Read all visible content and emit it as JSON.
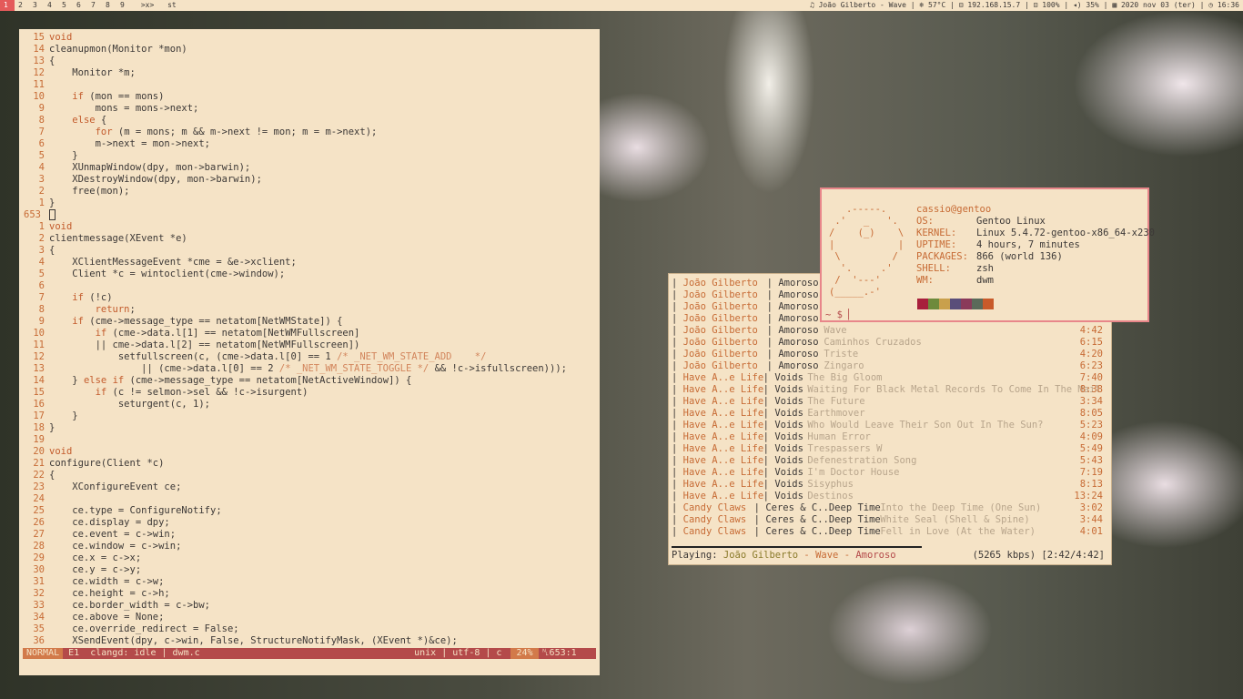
{
  "topbar": {
    "tags": [
      "1",
      "2",
      "3",
      "4",
      "5",
      "6",
      "7",
      "8",
      "9"
    ],
    "selected_tag": "1",
    "layout": ">x>",
    "window_title": "st",
    "status": "♫ João Gilberto - Wave | ❄ 57°C | ⊟ 192.168.15.7 | ⊡ 100% | ◂) 35% | ▦ 2020 nov 03 (ter) | ◷ 16:36"
  },
  "vim": {
    "lines": [
      {
        "n": "15",
        "t": "void"
      },
      {
        "n": "14",
        "t": "cleanupmon(Monitor *mon)"
      },
      {
        "n": "13",
        "t": "{"
      },
      {
        "n": "12",
        "t": "    Monitor *m;"
      },
      {
        "n": "11",
        "t": ""
      },
      {
        "n": "10",
        "t": "    if (mon == mons)"
      },
      {
        "n": "9",
        "t": "        mons = mons->next;"
      },
      {
        "n": "8",
        "t": "    else {"
      },
      {
        "n": "7",
        "t": "        for (m = mons; m && m->next != mon; m = m->next);"
      },
      {
        "n": "6",
        "t": "        m->next = mon->next;"
      },
      {
        "n": "5",
        "t": "    }"
      },
      {
        "n": "4",
        "t": "    XUnmapWindow(dpy, mon->barwin);"
      },
      {
        "n": "3",
        "t": "    XDestroyWindow(dpy, mon->barwin);"
      },
      {
        "n": "2",
        "t": "    free(mon);"
      },
      {
        "n": "1",
        "t": "}"
      },
      {
        "n": "653",
        "t": "█"
      },
      {
        "n": "1",
        "t": "void"
      },
      {
        "n": "2",
        "t": "clientmessage(XEvent *e)"
      },
      {
        "n": "3",
        "t": "{"
      },
      {
        "n": "4",
        "t": "    XClientMessageEvent *cme = &e->xclient;"
      },
      {
        "n": "5",
        "t": "    Client *c = wintoclient(cme->window);"
      },
      {
        "n": "6",
        "t": ""
      },
      {
        "n": "7",
        "t": "    if (!c)"
      },
      {
        "n": "8",
        "t": "        return;"
      },
      {
        "n": "9",
        "t": "    if (cme->message_type == netatom[NetWMState]) {"
      },
      {
        "n": "10",
        "t": "        if (cme->data.l[1] == netatom[NetWMFullscreen]"
      },
      {
        "n": "11",
        "t": "        || cme->data.l[2] == netatom[NetWMFullscreen])"
      },
      {
        "n": "12",
        "t": "            setfullscreen(c, (cme->data.l[0] == 1 /* _NET_WM_STATE_ADD    */"
      },
      {
        "n": "13",
        "t": "                || (cme->data.l[0] == 2 /* _NET_WM_STATE_TOGGLE */ && !c->isfullscreen)));"
      },
      {
        "n": "14",
        "t": "    } else if (cme->message_type == netatom[NetActiveWindow]) {"
      },
      {
        "n": "15",
        "t": "        if (c != selmon->sel && !c->isurgent)"
      },
      {
        "n": "16",
        "t": "            seturgent(c, 1);"
      },
      {
        "n": "17",
        "t": "    }"
      },
      {
        "n": "18",
        "t": "}"
      },
      {
        "n": "19",
        "t": ""
      },
      {
        "n": "20",
        "t": "void"
      },
      {
        "n": "21",
        "t": "configure(Client *c)"
      },
      {
        "n": "22",
        "t": "{"
      },
      {
        "n": "23",
        "t": "    XConfigureEvent ce;"
      },
      {
        "n": "24",
        "t": ""
      },
      {
        "n": "25",
        "t": "    ce.type = ConfigureNotify;"
      },
      {
        "n": "26",
        "t": "    ce.display = dpy;"
      },
      {
        "n": "27",
        "t": "    ce.event = c->win;"
      },
      {
        "n": "28",
        "t": "    ce.window = c->win;"
      },
      {
        "n": "29",
        "t": "    ce.x = c->x;"
      },
      {
        "n": "30",
        "t": "    ce.y = c->y;"
      },
      {
        "n": "31",
        "t": "    ce.width = c->w;"
      },
      {
        "n": "32",
        "t": "    ce.height = c->h;"
      },
      {
        "n": "33",
        "t": "    ce.border_width = c->bw;"
      },
      {
        "n": "34",
        "t": "    ce.above = None;"
      },
      {
        "n": "35",
        "t": "    ce.override_redirect = False;"
      },
      {
        "n": "36",
        "t": "    XSendEvent(dpy, c->win, False, StructureNotifyMask, (XEvent *)&ce);"
      }
    ],
    "status": {
      "mode": "NORMAL",
      "info": " E1  clangd: idle | dwm.c",
      "fileinfo": "unix | utf-8 | c ",
      "percent": "24%",
      "position": "␤653:1"
    }
  },
  "music": {
    "rows": [
      {
        "artist": "João Gilberto",
        "album": "Amoroso",
        "title": "",
        "dur": ""
      },
      {
        "artist": "João Gilberto",
        "album": "Amoroso",
        "title": "",
        "dur": ""
      },
      {
        "artist": "João Gilberto",
        "album": "Amoroso",
        "title": "",
        "dur": ""
      },
      {
        "artist": "João Gilberto",
        "album": "Amoroso",
        "title": "",
        "dur": ""
      },
      {
        "artist": "João Gilberto",
        "album": "Amoroso",
        "title": "Wave",
        "dur": "4:42"
      },
      {
        "artist": "João Gilberto",
        "album": "Amoroso",
        "title": "Caminhos Cruzados",
        "dur": "6:15"
      },
      {
        "artist": "João Gilberto",
        "album": "Amoroso",
        "title": "Triste",
        "dur": "4:20"
      },
      {
        "artist": "João Gilberto",
        "album": "Amoroso",
        "title": "Zingaro",
        "dur": "6:23"
      },
      {
        "artist": "Have A..e Life",
        "album": "Voids",
        "title": "The Big Gloom",
        "dur": "7:40"
      },
      {
        "artist": "Have A..e Life",
        "album": "Voids",
        "title": "Waiting For Black Metal Records To Come In The Mail",
        "dur": "8:38"
      },
      {
        "artist": "Have A..e Life",
        "album": "Voids",
        "title": "The Future",
        "dur": "3:34"
      },
      {
        "artist": "Have A..e Life",
        "album": "Voids",
        "title": "Earthmover",
        "dur": "8:05"
      },
      {
        "artist": "Have A..e Life",
        "album": "Voids",
        "title": "Who Would Leave Their Son Out In The Sun?",
        "dur": "5:23"
      },
      {
        "artist": "Have A..e Life",
        "album": "Voids",
        "title": "Human Error",
        "dur": "4:09"
      },
      {
        "artist": "Have A..e Life",
        "album": "Voids",
        "title": "Trespassers W",
        "dur": "5:49"
      },
      {
        "artist": "Have A..e Life",
        "album": "Voids",
        "title": "Defenestration Song",
        "dur": "5:43"
      },
      {
        "artist": "Have A..e Life",
        "album": "Voids",
        "title": "I'm Doctor House",
        "dur": "7:19"
      },
      {
        "artist": "Have A..e Life",
        "album": "Voids",
        "title": "Sisyphus",
        "dur": "8:13"
      },
      {
        "artist": "Have A..e Life",
        "album": "Voids",
        "title": "Destinos",
        "dur": "13:24"
      },
      {
        "artist": "Candy Claws",
        "album": "Ceres & C..Deep Time",
        "title": "Into the Deep Time (One Sun)",
        "dur": "3:02"
      },
      {
        "artist": "Candy Claws",
        "album": "Ceres & C..Deep Time",
        "title": "White Seal (Shell & Spine)",
        "dur": "3:44"
      },
      {
        "artist": "Candy Claws",
        "album": "Ceres & C..Deep Time",
        "title": "Fell in Love (At the Water)",
        "dur": "4:01"
      }
    ],
    "playing_label": "Playing:",
    "playing_artist": "João Gilberto",
    "playing_title": "Wave",
    "playing_album": "Amoroso",
    "playing_info": "(5265 kbps) [2:42/4:42]",
    "progress": 0.57
  },
  "fetch": {
    "ascii": "   .-----.\n .'   _   '.\n/    (_)    \\\n|           |\n \\         /\n  '.     .'\n /  '---'\n(_____.-'",
    "user_host": "cassio@gentoo",
    "fields": [
      {
        "k": "OS:",
        "v": "Gentoo Linux"
      },
      {
        "k": "KERNEL:",
        "v": "Linux 5.4.72-gentoo-x86_64-x230"
      },
      {
        "k": "UPTIME:",
        "v": "4 hours, 7 minutes"
      },
      {
        "k": "PACKAGES:",
        "v": "866 (world 136)"
      },
      {
        "k": "SHELL:",
        "v": "zsh"
      },
      {
        "k": "WM:",
        "v": "dwm"
      }
    ],
    "palette": [
      "#a8203c",
      "#6e8a3c",
      "#c9a04c",
      "#5a4e7a",
      "#8a3a5a",
      "#5a6a5a",
      "#c85a2a"
    ],
    "prompt": "~ $ ▏"
  }
}
